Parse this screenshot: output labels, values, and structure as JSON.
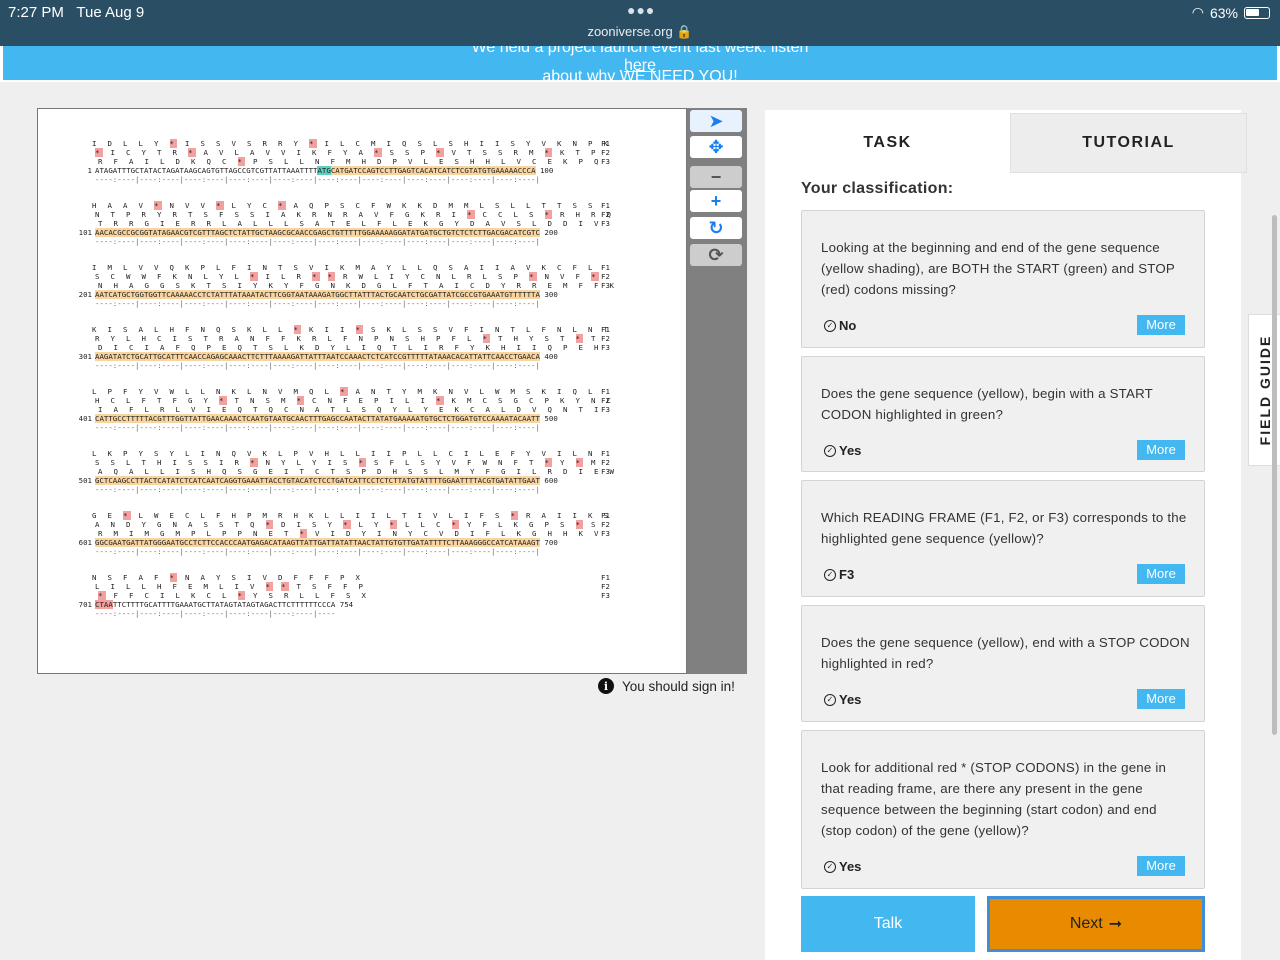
{
  "status_bar": {
    "time": "7:27 PM",
    "date": "Tue Aug 9",
    "url": "zooniverse.org",
    "battery": "63%",
    "battery_level": 0.63
  },
  "banner": {
    "text_before": "We held a project launch event last week: listen ",
    "link": "here",
    "text_after": " about why WE NEED YOU!"
  },
  "sequence": {
    "blocks": [
      {
        "num": "1",
        "f1": "I D L L Y * I S S V S R R Y * I L C M I Q S L S H I I S Y V K N P K",
        "f2": "* I C Y T R * A V L A V V I K F Y A * S S P * V T S S R M * K T P",
        "f3": "R F A I L D K Q C * P S L L N F M H D P V L E S H H L V C E K P Q",
        "dna_a": "ATAGATTTGCTATACTAGATAAGCAGTGTTAGCCGTCGTTATTAAATTTT",
        "dna_start": "ATG",
        "dna_b": "CATGATCCAGTCCTTGAGTCACATCATCTCGTATGTGAAAAACCCA",
        "end": "100"
      },
      {
        "num": "101",
        "f1": "H A A V * N V V * L Y C * A Q P S C F W K K D M M L S L L T T S S",
        "f2": "N T P R Y R T S F S S I A K R N R A V F G K R I * C C L S * R H R Q",
        "f3": "T R R G I E R R L A L L L S A T E L F L E K G Y D A V S L D D I V",
        "dna_a": "AACACGCCGCGGTATAGAACGTCGTTTAGCTCTATTGCTAAGCGCAACCGAGCTGTTTTTGGAAAAAGGATATGATGCTGTCTCTCTTGACGACATCGTC",
        "end": "200"
      },
      {
        "num": "201",
        "f1": "I M L V V Q K P L F I N T S V I K M A Y L L Q S A I I A V K C F L",
        "f2": "S C W W F K N L Y L * I L R * * R W L I Y C N L R L S P * N V F *",
        "f3": "N H A G G S K T S I Y K Y F G N K D G L F T A I C D Y R R E M F F K",
        "dna_a": "AATCATGCTGGTGGTTCAAAAACCTCTATTTATAAATACTTCGGTAATAAAGATGGCTTATTTACTGCAATCTGCGATTATCGCCGTGAAATGTTTTTTA",
        "end": "300"
      },
      {
        "num": "301",
        "f1": "K I S A L H F N Q S K L L * K I I * S K L S S V F I N T L F N L N T",
        "f2": "R Y L H C I S T R A N F F K R L F N P N S H P F L * T H Y S T * T",
        "f3": "D I C I A F Q P E Q T S L K D Y L I Q T L I R F Y K H I I Q P E H",
        "dna_a": "AAGATATCTGCATTGCATTTCAACCAGAGCAAACTTCTTTAAAAGATTATTTAATCCAAACTCTCATCCGTTTTTATAAACACATTATTCAACCTGAACA",
        "end": "400"
      },
      {
        "num": "401",
        "f1": "L P F Y V W L L N K L N V M Q L * A N T Y M K N V L W M S K I Q L",
        "f2": "H C L F T F G Y * T N S M * C N F E P I L I * K M C S G C P K Y N C",
        "f3": "I A F L R L V I E Q T Q C N A T L S Q Y L Y E K C A L D V Q N T I",
        "dna_a": "CATTGCCTTTTTACGTTTGGTTATTGAACAAACTCAATGTAATGCAACTTTGAGCCAATACTTATATGAAAAATGTGCTCTGGATGTCCAAAATACAATT",
        "end": "500"
      },
      {
        "num": "501",
        "f1": "L K P Y S Y L I N Q V K L P V H L L I I P L L C I L E F Y V I L N",
        "f2": "S S L T H I S S I R * N Y L Y I S * S F L S Y V F W N F T * Y * M",
        "f3": "A Q A L L I S H Q S G E I T C T S P D H S S L M Y F G I L R D I E W",
        "dna_a": "GCTCAAGCCTTACTCATATCTCATCAATCAGGTGAAATTACCTGTACATCTCCTGATCATTCCTCTCTTATGTATTTTGGAATTTTACGTGATATTGAAT",
        "end": "600"
      },
      {
        "num": "601",
        "f1": "G E * L W E C L F H P M R H K L L I I L T I V L I F S * R A I I K S",
        "f2": "A N D Y G N A S S T Q * D I S Y * L Y * L L C * Y F L K G P S * S",
        "f3": "R M I M G M P L P P N E T * V I D Y I N Y C V D I F L K G H H K V",
        "dna_a": "GGCGAATGATTATGGGAATGCCTCTTCCACCCAATGAGACATAAGTTATTGATTATATTAACTATTGTGTTGATATTTTCTTAAAGGGCCATCATAAAGT",
        "end": "700"
      },
      {
        "num": "701",
        "f1": "N S F A F * N A Y S I V D F F F P X",
        "f2": "L I L L H F E M L I V * * T S F F P",
        "f3": "* F F C I L K C L * Y S R L L F S X",
        "dna_stop": "CTAA",
        "dna_b": "TTCTTTTGCATTTTGAAATGCTTATAGTATAGTAGACTTCTTTTTTCCCA",
        "end": "754"
      }
    ],
    "frames": [
      "F1",
      "F2",
      "F3"
    ],
    "ruler": "----:----|----:----|----:----|----:----|----:----|----:----|----:----|----:----|----:----|----:----|",
    "ruler_last": "----:----|----:----|----:----|----:----|----:----|----"
  },
  "toolbar": {
    "tools": [
      "pointer-icon",
      "move-icon",
      "zoom-out-icon",
      "zoom-in-icon",
      "rotate-icon",
      "reset-icon"
    ]
  },
  "signin": "You should sign in!",
  "tabs": {
    "task": "TASK",
    "tutorial": "TUTORIAL"
  },
  "classification_heading": "Your classification:",
  "questions": [
    {
      "question": "Looking at the beginning and end of the gene sequence (yellow shading), are BOTH the START (green) and STOP (red) codons missing?",
      "answer": "No",
      "more": "More"
    },
    {
      "question": "Does the gene sequence (yellow), begin with a START CODON highlighted in green?",
      "answer": "Yes",
      "more": "More"
    },
    {
      "question": "Which READING FRAME (F1, F2, or F3) corresponds to the highlighted gene sequence (yellow)?",
      "answer": "F3",
      "more": "More"
    },
    {
      "question": "Does the gene sequence (yellow), end with a STOP CODON highlighted in red?",
      "answer": "Yes",
      "more": "More"
    },
    {
      "question": "Look for additional red * (STOP CODONS) in the gene in that reading frame, are there any present in the gene sequence between the beginning (start codon) and end (stop codon) of the gene (yellow)?",
      "answer": "Yes",
      "more": "More"
    }
  ],
  "buttons": {
    "talk": "Talk",
    "next": "Next",
    "next_arrow": "➞"
  },
  "field_guide": "FIELD GUIDE",
  "colors": {
    "accent": "#43b7f0",
    "next": "#e88b00",
    "status_bar": "#2a4f65",
    "dna_highlight": "#f8d4a0",
    "start_codon": "#5fd0be",
    "stop_codon": "#f3a0a0"
  }
}
